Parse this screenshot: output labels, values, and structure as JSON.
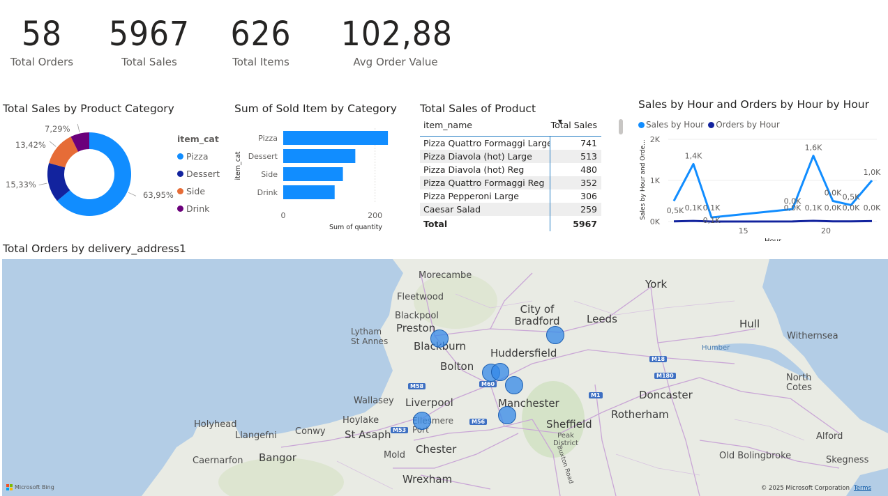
{
  "kpis": [
    {
      "value": "58",
      "label": "Total Orders"
    },
    {
      "value": "5967",
      "label": "Total Sales"
    },
    {
      "value": "626",
      "label": "Total Items"
    },
    {
      "value": "102,88",
      "label": "Avg Order Value"
    }
  ],
  "donut": {
    "title": "Total Sales by Product Category",
    "legend_title": "item_cat",
    "chart_data": {
      "type": "pie",
      "categories": [
        "Pizza",
        "Dessert",
        "Side",
        "Drink"
      ],
      "values": [
        63.95,
        15.33,
        13.42,
        7.29
      ],
      "labels": [
        "63,95%",
        "15,33%",
        "13,42%",
        "7,29%"
      ],
      "colors": [
        "#118dff",
        "#12239e",
        "#e66c37",
        "#6b007b"
      ]
    }
  },
  "bar": {
    "title": "Sum of Sold Item by Category",
    "chart_data": {
      "type": "bar",
      "categories": [
        "Pizza",
        "Dessert",
        "Side",
        "Drink"
      ],
      "values": [
        228,
        157,
        130,
        112
      ],
      "xlabel": "Sum of quantity",
      "ylabel": "item_cat",
      "xticks": [
        "0",
        "200"
      ],
      "xlim": [
        0,
        240
      ]
    }
  },
  "table": {
    "title": "Total Sales of Product",
    "col1": "item_name",
    "col2": "Total Sales",
    "rows": [
      {
        "name": "Pizza Quattro Formaggi Large",
        "value": "741"
      },
      {
        "name": "Pizza Diavola (hot) Large",
        "value": "513"
      },
      {
        "name": "Pizza Diavola (hot) Reg",
        "value": "480"
      },
      {
        "name": "Pizza Quattro Formaggi Reg",
        "value": "352"
      },
      {
        "name": "Pizza Pepperoni Large",
        "value": "306"
      },
      {
        "name": "Caesar Salad",
        "value": "259"
      }
    ],
    "total_label": "Total",
    "total_value": "5967"
  },
  "line": {
    "title": "Sales by Hour and Orders by Hour by Hour",
    "legend": [
      "Sales by Hour",
      "Orders by Hour"
    ],
    "chart_data": {
      "type": "line",
      "x": [
        11,
        12,
        13,
        19,
        20,
        21,
        22,
        23
      ],
      "series": [
        {
          "name": "Sales by Hour",
          "values": [
            0.5,
            1.4,
            0.1,
            0.3,
            1.6,
            0.5,
            0.4,
            1.0
          ],
          "labels": [
            "0,5K",
            "1,4K",
            "0,1K",
            "0,0K",
            "1,6K",
            "0,0K",
            "0,5K",
            "1,0K"
          ],
          "color": "#118dff"
        },
        {
          "name": "Orders by Hour",
          "values": [
            0.005,
            0.014,
            0.001,
            0.003,
            0.016,
            0.005,
            0.004,
            0.01
          ],
          "labels": [
            "0,0K",
            "0,1K",
            "0,1K",
            "0,0K",
            "0,1K",
            "0,0K",
            "0,0K",
            "0,0K"
          ],
          "color": "#12239e"
        }
      ],
      "ylabel": "Sales by Hour and Orde...",
      "xlabel": "Hour",
      "yticks": [
        "0K",
        "1K",
        "2K"
      ],
      "xticks": [
        "15",
        "20"
      ],
      "ylim": [
        0,
        2
      ]
    }
  },
  "map": {
    "title": "Total Orders by delivery_address1",
    "places": [
      "Morecambe",
      "Fleetwood",
      "Blackpool",
      "Preston",
      "Lytham St Annes",
      "Blackburn",
      "Bolton",
      "Huddersfield",
      "City of Bradford",
      "Leeds",
      "York",
      "Hull",
      "Withernsea",
      "Humber",
      "North Cotes",
      "Doncaster",
      "Rotherham",
      "Sheffield",
      "Peak District",
      "Manchester",
      "Liverpool",
      "Wallasey",
      "Hoylake",
      "Ellesmere Port",
      "St Asaph",
      "Chester",
      "Holyhead",
      "Llangefni",
      "Conwy",
      "Bangor",
      "Caernarfon",
      "Mold",
      "Wrexham",
      "Alford",
      "Skegness",
      "Old Bolingbroke",
      "Buxton Road"
    ],
    "roads": [
      "M60",
      "M58",
      "M56",
      "M53",
      "M18",
      "M180",
      "M1"
    ],
    "attribution": "Microsoft Bing",
    "copyright": "© 2025 Microsoft Corporation",
    "terms": "Terms"
  }
}
